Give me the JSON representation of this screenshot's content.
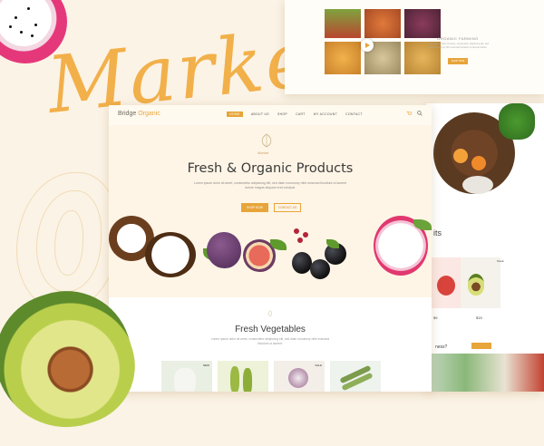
{
  "theme": {
    "accent": "#e7a53a",
    "background": "#fbf3e6"
  },
  "hero_decor": {
    "script_word": "Market"
  },
  "video_section": {
    "title": "ORGANIC FARMING",
    "text": "Lorem ipsum dolor sit amet, consectetur adipiscing elit, sed diam nonummy nibh euismod tincidunt ut laoreet dolore",
    "button": "SHOP NOW"
  },
  "site": {
    "logo_prefix": "Bridge",
    "logo_accent": "Organic",
    "nav": [
      "HOME",
      "ABOUT US",
      "SHOP",
      "CART",
      "MY ACCOUNT",
      "CONTACT"
    ],
    "nav_icons": [
      "cart-icon",
      "search-icon"
    ]
  },
  "hero": {
    "badge_word": "Market",
    "title": "Fresh & Organic Products",
    "subtitle": "Lorem ipsum dolor sit amet, consectetur adipiscing elit, sed diam nonummy nibh euismod tincidunt ut laoreet dolore magna aliquam erat volutpat.",
    "shop_button": "SHOP NOW",
    "contact_button": "CONTACT US"
  },
  "vegetables": {
    "title": "Fresh Vegetables",
    "subtitle": "Lorem ipsum dolor sit amet, consectetur adipiscing elit, sed diam nonummy nibh euismod tincidunt ut laoreet.",
    "tags": [
      "NEW",
      "SALE"
    ]
  },
  "right_panel": {
    "heading_fragment": "its",
    "card_tag": "SALE",
    "prices": [
      "$9",
      "$15"
    ],
    "bottom_fragment": "ness?"
  }
}
